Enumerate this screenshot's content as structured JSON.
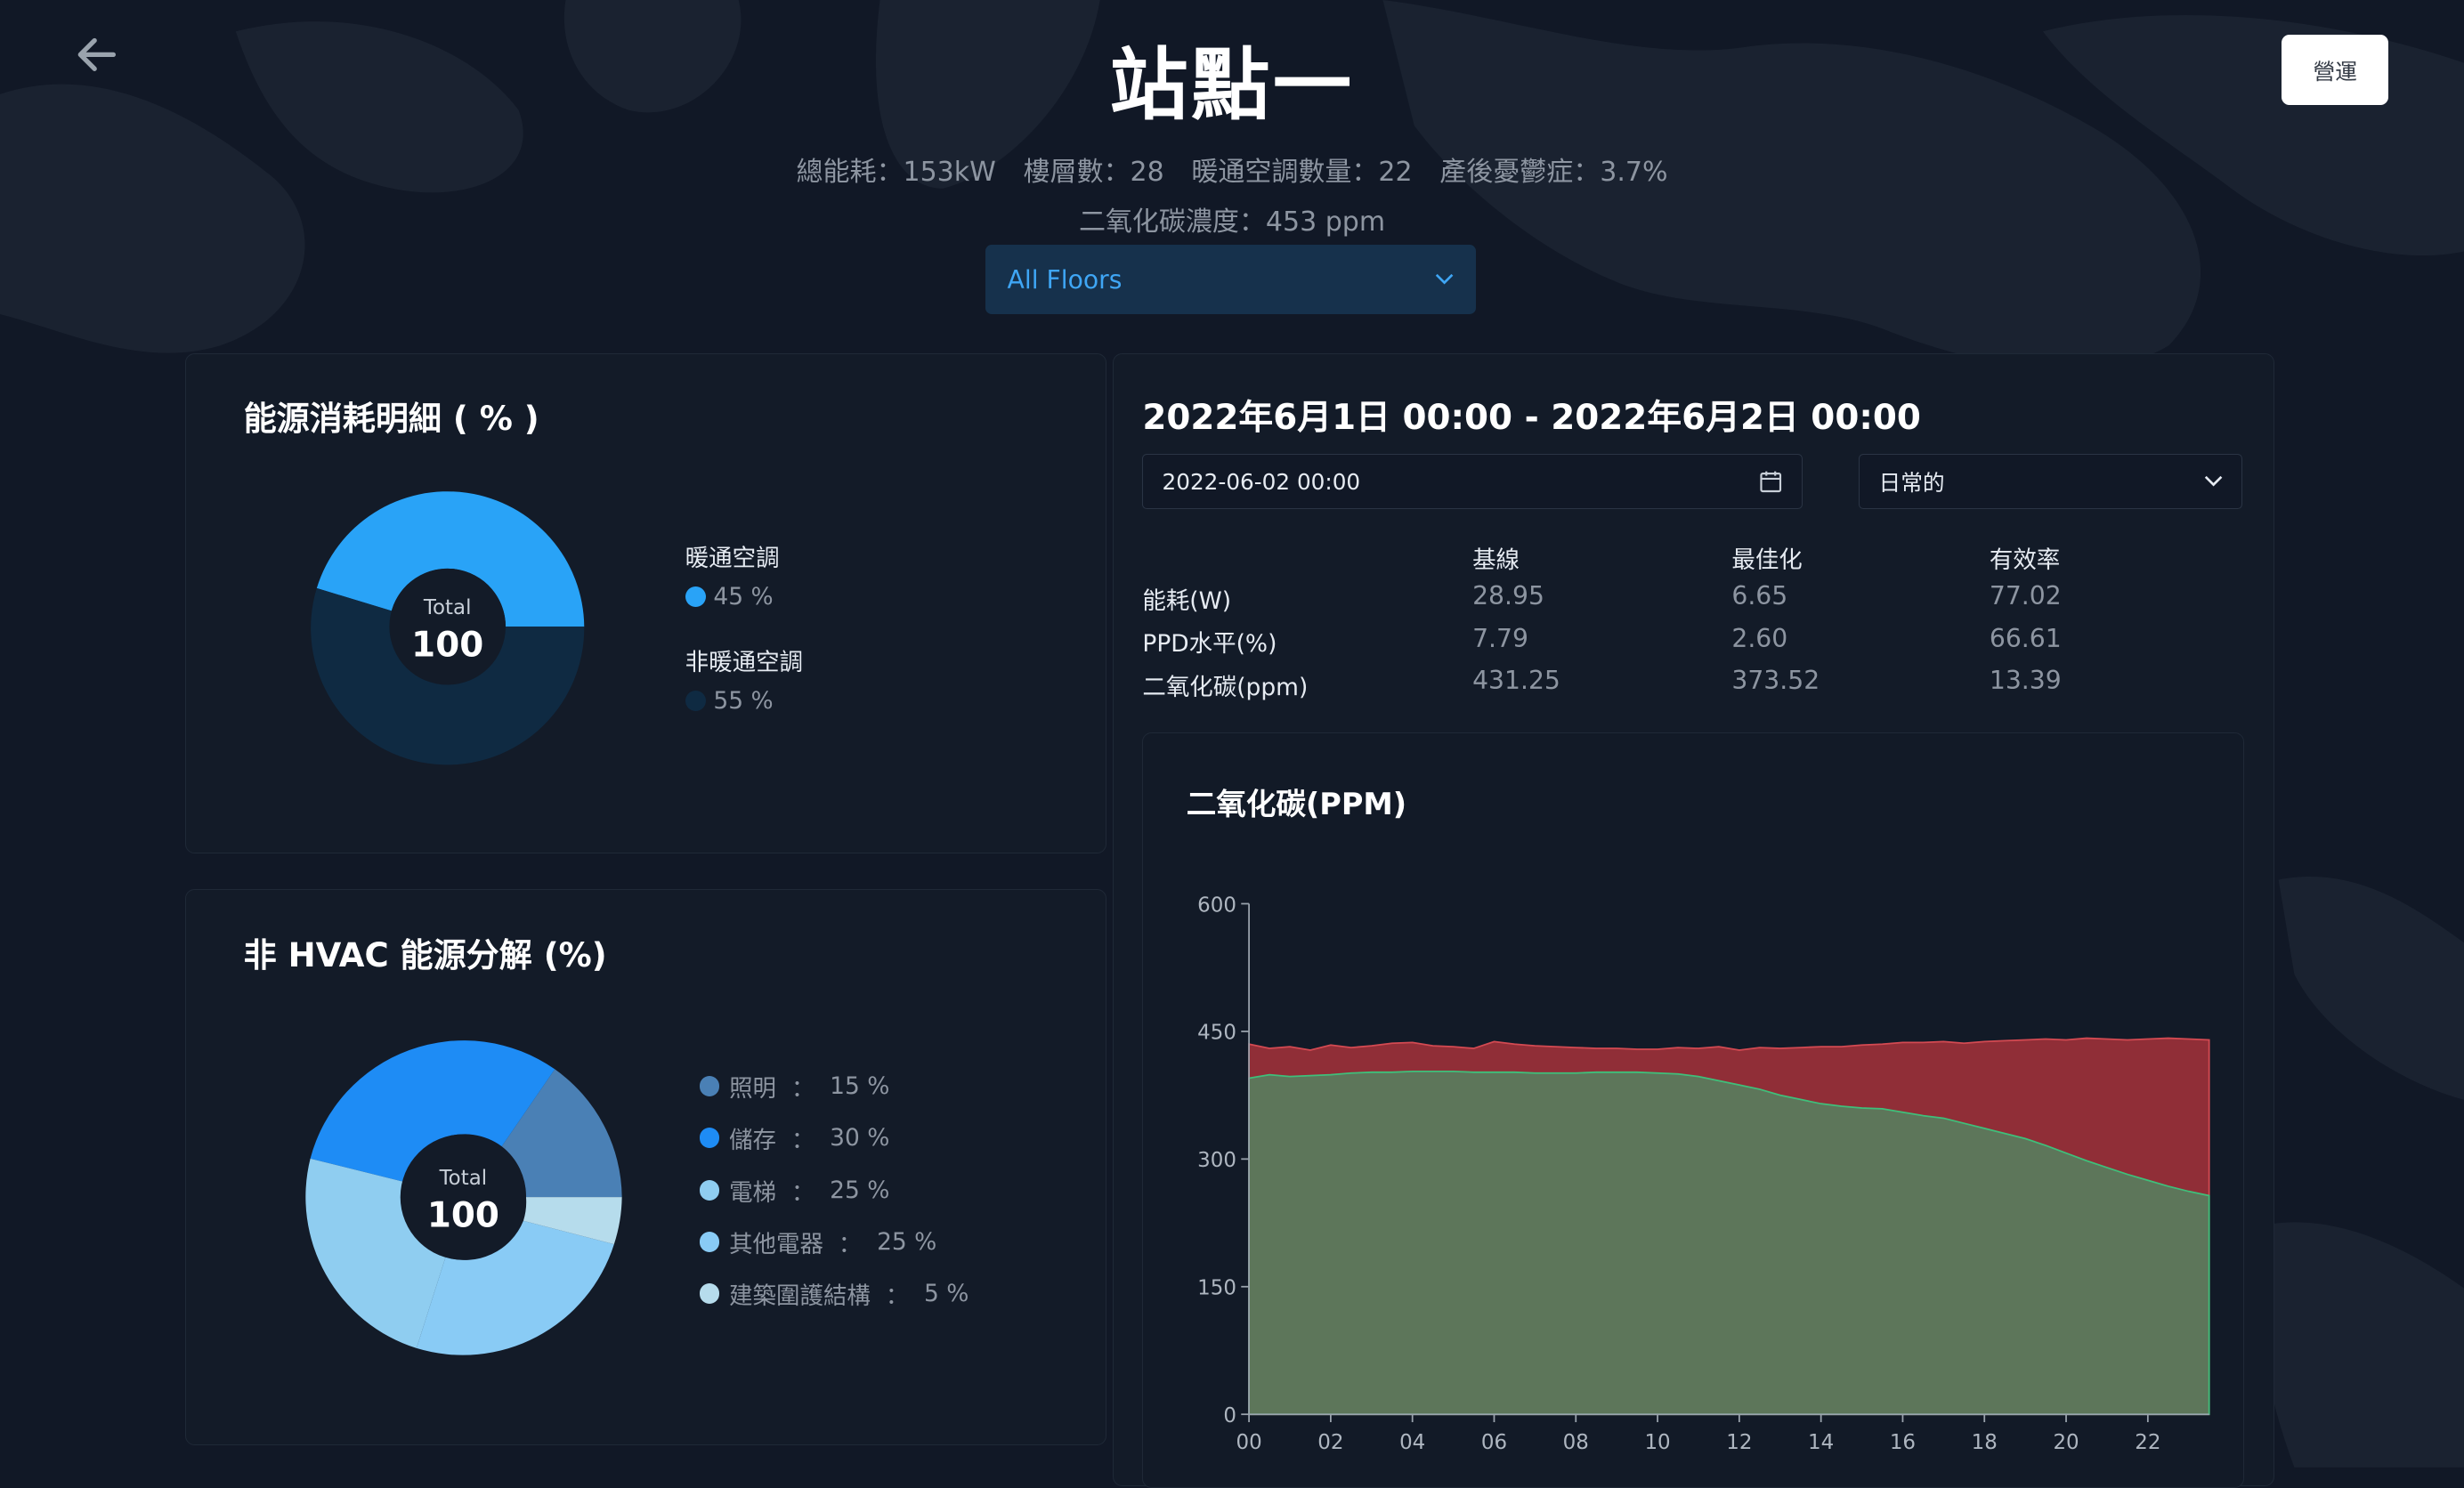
{
  "header": {
    "title": "站點一",
    "op_button": "營運",
    "stats_line1": [
      "總能耗：153kW",
      "樓層數：28",
      "暖通空調數量：22",
      "產後憂鬱症：3.7%"
    ],
    "stats_line2": "二氧化碳濃度：453 ppm",
    "floor_select": "All Floors"
  },
  "energy_card": {
    "title": "能源消耗明細 ( % )",
    "center_label": "Total",
    "center_value": "100",
    "legend": [
      {
        "label": "暖通空調",
        "value": "45 %",
        "color": "#29a3f7"
      },
      {
        "label": "非暖通空調",
        "value": "55 %",
        "color": "#0f2a42"
      }
    ],
    "slices": [
      45,
      55
    ]
  },
  "nonhvac_card": {
    "title": "非 HVAC 能源分解 (%)",
    "center_label": "Total",
    "center_value": "100",
    "legend": [
      {
        "label": "照明",
        "sep": "：",
        "value": "15 %",
        "color": "#4a80b5"
      },
      {
        "label": "儲存",
        "sep": "：",
        "value": "30 %",
        "color": "#1e8cf5"
      },
      {
        "label": "電梯",
        "sep": "：",
        "value": "25 %",
        "color": "#8fcdf0"
      },
      {
        "label": "其他電器",
        "sep": "：",
        "value": "25 %",
        "color": "#89cbf5"
      },
      {
        "label": "建築圍護結構",
        "sep": "：",
        "value": "5 %",
        "color": "#b6dcec"
      }
    ]
  },
  "detail": {
    "range_title": "2022年6月1日 00:00 - 2022年6月2日 00:00",
    "date_value": "2022-06-02 00:00",
    "mode_select": "日常的",
    "columns": [
      "基線",
      "最佳化",
      "有效率"
    ],
    "rows": [
      {
        "label": "能耗(W)",
        "values": [
          "28.95",
          "6.65",
          "77.02"
        ]
      },
      {
        "label": "PPD水平(%)",
        "values": [
          "7.79",
          "2.60",
          "66.61"
        ]
      },
      {
        "label": "二氧化碳(ppm)",
        "values": [
          "431.25",
          "373.52",
          "13.39"
        ]
      }
    ]
  },
  "chart_data": {
    "type": "area",
    "title": "二氧化碳(PPM)",
    "xlabel": "",
    "ylabel": "",
    "ylim": [
      0,
      600
    ],
    "yticks": [
      "0",
      "150",
      "300",
      "450",
      "600"
    ],
    "xticks": [
      "00",
      "02",
      "04",
      "06",
      "08",
      "10",
      "12",
      "14",
      "16",
      "18",
      "20",
      "22"
    ],
    "grid": false,
    "colors": {
      "baseline": "#b3353c",
      "optimized": "#5b7a5c"
    },
    "x": [
      0,
      0.5,
      1,
      1.5,
      2,
      2.5,
      3,
      3.5,
      4,
      4.5,
      5,
      5.5,
      6,
      6.5,
      7,
      7.5,
      8,
      8.5,
      9,
      9.5,
      10,
      10.5,
      11,
      11.5,
      12,
      12.5,
      13,
      13.5,
      14,
      14.5,
      15,
      15.5,
      16,
      16.5,
      17,
      17.5,
      18,
      18.5,
      19,
      19.5,
      20,
      20.5,
      21,
      21.5,
      22,
      22.5,
      23,
      23.5
    ],
    "series": [
      {
        "name": "",
        "values": [
          435,
          430,
          432,
          428,
          434,
          431,
          433,
          436,
          437,
          433,
          432,
          430,
          438,
          435,
          433,
          432,
          431,
          430,
          430,
          429,
          429,
          431,
          430,
          432,
          428,
          431,
          430,
          431,
          432,
          432,
          434,
          435,
          437,
          437,
          438,
          436,
          438,
          439,
          440,
          441,
          440,
          442,
          441,
          440,
          441,
          442,
          441,
          440
        ]
      },
      {
        "name": "",
        "values": [
          395,
          399,
          397,
          398,
          399,
          401,
          402,
          402,
          403,
          403,
          403,
          402,
          402,
          402,
          401,
          401,
          401,
          402,
          402,
          402,
          401,
          400,
          397,
          392,
          387,
          382,
          375,
          370,
          365,
          362,
          360,
          359,
          355,
          351,
          348,
          342,
          336,
          330,
          324,
          316,
          307,
          298,
          290,
          282,
          275,
          268,
          262,
          257
        ]
      }
    ]
  }
}
